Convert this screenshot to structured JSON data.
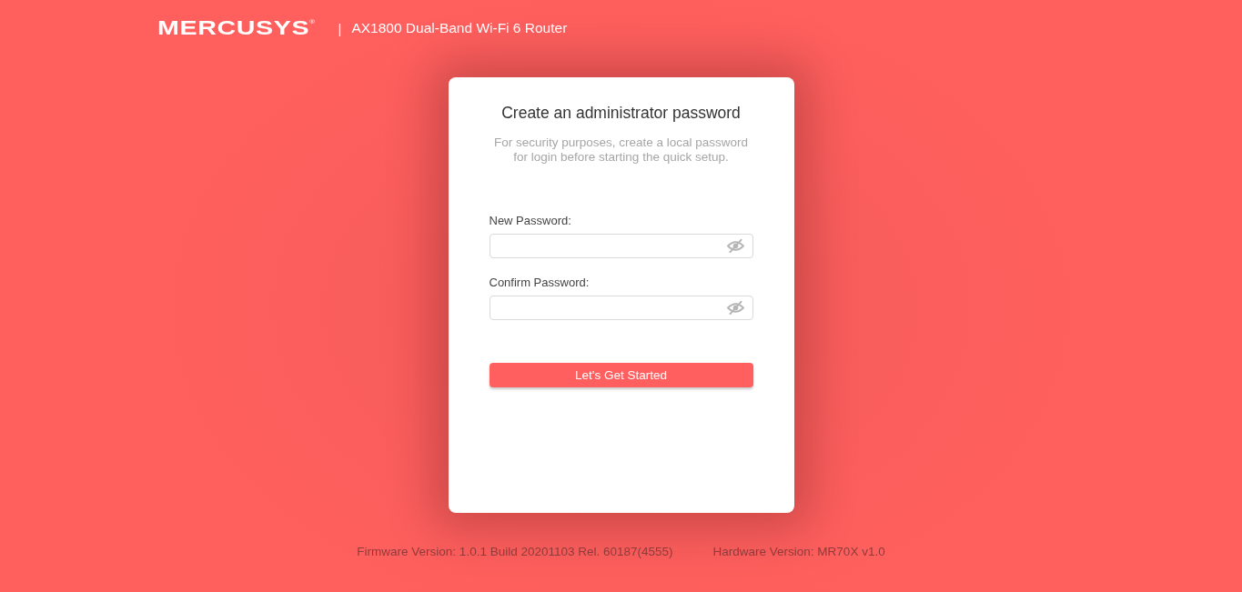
{
  "header": {
    "logo": "MERCUSYS$^{®}$",
    "separator": "|",
    "product": "AX1800 Dual-Band Wi-Fi 6 Router"
  },
  "card": {
    "title": "Create an administrator password",
    "subtitle": "For security purposes, create a local password for login before starting the quick setup.",
    "fields": [
      {
        "label": "New Password:",
        "visible": false
      },
      {
        "label": "Confirm Password:",
        "visible": false
      }
    ],
    "button": "Let's Get Started"
  },
  "footer": {
    "firmware": "Firmware Version: 1.0.1 Build 20201103 Rel. 60187(4555)",
    "hardware": "Hardware Version: MR70X v1.0"
  }
}
